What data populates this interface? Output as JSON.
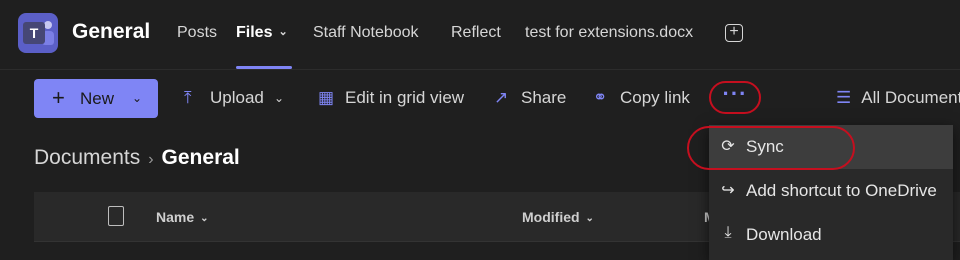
{
  "header": {
    "channel_title": "General",
    "tabs": [
      {
        "label": "Posts"
      },
      {
        "label": "Files",
        "active": true
      },
      {
        "label": "Staff Notebook"
      },
      {
        "label": "Reflect"
      },
      {
        "label": "test for extensions.docx"
      }
    ],
    "add_tab_glyph": "+"
  },
  "toolbar": {
    "new_label": "New",
    "upload_label": "Upload",
    "grid_label": "Edit in grid view",
    "share_label": "Share",
    "copy_link_label": "Copy link",
    "more_glyph": "···",
    "all_docs_label": "All Documents",
    "accent_color": "#7f85f5"
  },
  "breadcrumb": {
    "root": "Documents",
    "current": "General"
  },
  "table": {
    "columns": [
      "Name",
      "Modified",
      "M"
    ]
  },
  "menu": {
    "items": [
      {
        "label": "Sync",
        "icon": "sync-icon"
      },
      {
        "label": "Add shortcut to OneDrive",
        "icon": "add-shortcut-icon"
      },
      {
        "label": "Download",
        "icon": "download-icon"
      }
    ]
  },
  "highlight_color": "#c50f1f"
}
